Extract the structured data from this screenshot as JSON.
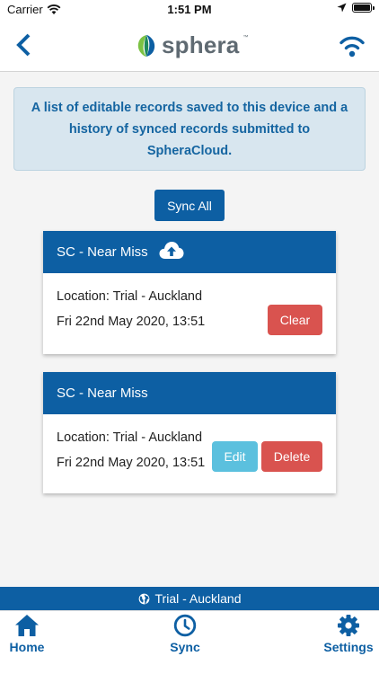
{
  "status_bar": {
    "carrier": "Carrier",
    "time": "1:51 PM"
  },
  "header": {
    "logo_text": "sphera",
    "logo_tm": "™"
  },
  "info": {
    "message": "A list of editable records saved to this device and a history of synced records submitted to SpheraCloud."
  },
  "sync_all_label": "Sync All",
  "records": [
    {
      "title": "SC - Near Miss",
      "location": "Location: Trial - Auckland",
      "date": "Fri 22nd May 2020, 13:51",
      "clear_label": "Clear"
    },
    {
      "title": "SC - Near Miss",
      "location": "Location: Trial - Auckland",
      "date": "Fri 22nd May 2020, 13:51",
      "edit_label": "Edit",
      "delete_label": "Delete"
    }
  ],
  "location_bar": {
    "label": "Trial - Auckland"
  },
  "tabs": [
    {
      "label": "Home",
      "icon": "home-icon"
    },
    {
      "label": "Sync",
      "icon": "clock-icon"
    },
    {
      "label": "Settings",
      "icon": "gear-icon"
    }
  ],
  "colors": {
    "primary": "#0d5fa3",
    "danger": "#d9534f",
    "info": "#5bc0de",
    "info_box_bg": "#d8e6ef"
  }
}
